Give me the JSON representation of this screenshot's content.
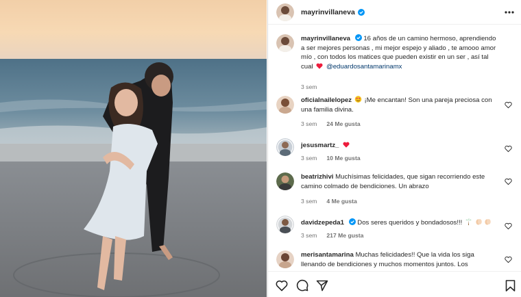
{
  "post": {
    "username": "mayrinvillaneva",
    "more_icon": "more-horizontal-icon"
  },
  "caption": {
    "username": "mayrinvillaneva",
    "text": "16 años de un camino hermoso, aprendiendo a ser mejores personas , mi mejor espejo y aliado , te amooo amor mío , con todos los matices que pueden existir en un ser , así tal cual",
    "mention": "@eduardosantamarinamx",
    "time": "3 sem"
  },
  "comments": [
    {
      "username": "oficialnailelopez",
      "text": "¡Me encantan! Son una pareja preciosa con una familia divina.",
      "time": "3 sem",
      "likes": "24 Me gusta"
    },
    {
      "username": "jesusmartz_",
      "text": "",
      "time": "3 sem",
      "likes": "10 Me gusta"
    },
    {
      "username": "beatrizhivi",
      "text": "Muchísimas felicidades, que sigan recorriendo este camino colmado de bendiciones. Un abrazo",
      "time": "3 sem",
      "likes": "4 Me gusta"
    },
    {
      "username": "davidzepeda1",
      "text": "Dos seres queridos y bondadosos!!!",
      "time": "3 sem",
      "likes": "217 Me gusta"
    },
    {
      "username": "merisantamarina",
      "text": "Muchas felicidades!! Que la vida los siga llenando de bendiciones y muchos momentos juntos. Los",
      "time": "",
      "likes": ""
    }
  ],
  "actions": {
    "like_icon": "heart-outline-icon",
    "comment_icon": "comment-icon",
    "share_icon": "send-icon",
    "save_icon": "bookmark-icon"
  },
  "colors": {
    "verified_blue": "#0095f6",
    "heart_red": "#ed1c3c",
    "link_blue": "#00376b",
    "meta_gray": "#737373"
  }
}
